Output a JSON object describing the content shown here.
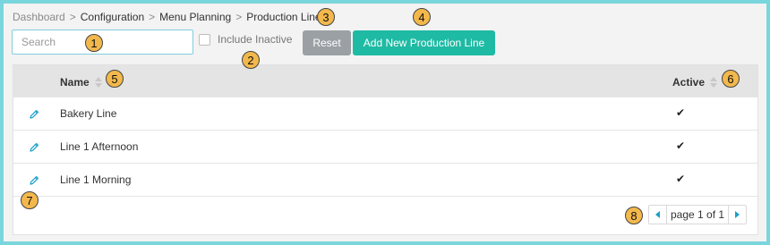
{
  "breadcrumb": {
    "items": [
      "Dashboard",
      "Configuration",
      "Menu Planning",
      "Production Lines"
    ],
    "separator": ">"
  },
  "search": {
    "placeholder": "Search",
    "value": ""
  },
  "include_inactive": {
    "label": "Include Inactive",
    "checked": false
  },
  "buttons": {
    "reset": "Reset",
    "add": "Add New Production Line"
  },
  "table": {
    "columns": {
      "name": "Name",
      "active": "Active"
    },
    "rows": [
      {
        "name": "Bakery Line",
        "active": "✔"
      },
      {
        "name": "Line 1 Afternoon",
        "active": "✔"
      },
      {
        "name": "Line 1 Morning",
        "active": "✔"
      }
    ]
  },
  "pagination": {
    "text": "page 1 of 1"
  },
  "callouts": [
    "1",
    "2",
    "3",
    "4",
    "5",
    "6",
    "7",
    "8"
  ],
  "colors": {
    "accent": "#1ebaa3",
    "reset": "#9aa0a4",
    "edit_icon": "#1a9fc7",
    "callout": "#f3b84c",
    "border_frame": "#7ad6dd"
  },
  "icons": {
    "edit": "pencil-icon",
    "sort": "sort-icon",
    "check": "check-icon",
    "prev": "chevron-left-icon",
    "next": "chevron-right-icon"
  }
}
